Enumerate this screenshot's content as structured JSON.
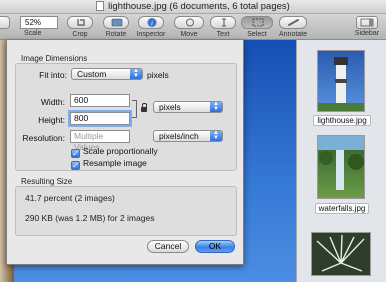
{
  "window": {
    "title": "lighthouse.jpg (6 documents, 6 total pages)"
  },
  "toolbar": {
    "zoom_value": "52%",
    "items": [
      {
        "label": "Scale",
        "icon": "zoom-icon"
      },
      {
        "label": "Crop",
        "icon": "crop-icon"
      },
      {
        "label": "Rotate",
        "icon": "rotate-icon"
      },
      {
        "label": "Inspector",
        "icon": "info-icon"
      },
      {
        "label": "Move",
        "icon": "move-icon"
      },
      {
        "label": "Text",
        "icon": "text-cursor-icon"
      },
      {
        "label": "Select",
        "icon": "select-icon"
      },
      {
        "label": "Annotate",
        "icon": "annotate-icon"
      },
      {
        "label": "Sidebar",
        "icon": "sidebar-icon"
      }
    ]
  },
  "dialog": {
    "image_dimensions_title": "Image Dimensions",
    "fit_into_label": "Fit into:",
    "fit_into_value": "Custom",
    "fit_into_unit": "pixels",
    "width_label": "Width:",
    "width_value": "600",
    "height_label": "Height:",
    "height_value": "800",
    "size_unit": "pixels",
    "resolution_label": "Resolution:",
    "resolution_placeholder": "Multiple Values",
    "resolution_unit": "pixels/inch",
    "scale_proportionally": "Scale proportionally",
    "scale_proportionally_checked": true,
    "resample_image": "Resample image",
    "resample_image_checked": true,
    "resulting_size_title": "Resulting Size",
    "result_percent": "41.7 percent (2 images)",
    "result_size": "290 KB (was 1.2 MB) for 2 images",
    "cancel_label": "Cancel",
    "ok_label": "OK"
  },
  "sidebar": {
    "thumbnails": [
      {
        "label": "lighthouse.jpg"
      },
      {
        "label": "waterfalls.jpg"
      },
      {
        "label": ""
      }
    ]
  },
  "colors": {
    "accent": "#3b81e4",
    "sky": "#2a66c6"
  }
}
